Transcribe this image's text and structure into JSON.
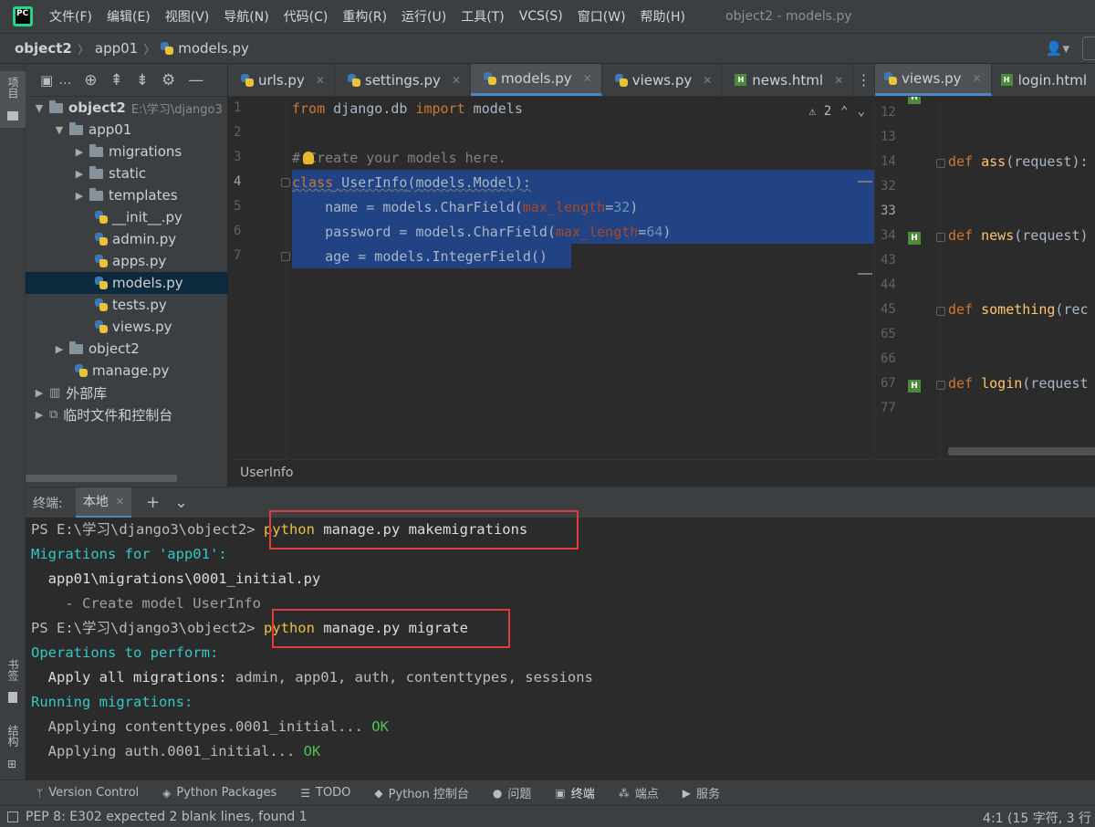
{
  "menubar": {
    "logo_text": "PC",
    "items": [
      "文件(F)",
      "编辑(E)",
      "视图(V)",
      "导航(N)",
      "代码(C)",
      "重构(R)",
      "运行(U)",
      "工具(T)",
      "VCS(S)",
      "窗口(W)",
      "帮助(H)"
    ],
    "window_title": "object2 - models.py"
  },
  "navbar": {
    "crumbs": [
      "object2",
      "app01",
      "models.py"
    ]
  },
  "left_stripe": {
    "project_label": "项目",
    "bookmarks_label": "书签",
    "structure_label": "结构"
  },
  "project": {
    "toolbar_label": "…",
    "tree": [
      {
        "label": "object2",
        "path": "E:\\学习\\django3"
      },
      {
        "label": "app01"
      },
      {
        "label": "migrations"
      },
      {
        "label": "static"
      },
      {
        "label": "templates"
      },
      {
        "label": "__init__.py"
      },
      {
        "label": "admin.py"
      },
      {
        "label": "apps.py"
      },
      {
        "label": "models.py"
      },
      {
        "label": "tests.py"
      },
      {
        "label": "views.py"
      },
      {
        "label": "object2"
      },
      {
        "label": "manage.py"
      },
      {
        "label": "外部库"
      },
      {
        "label": "临时文件和控制台"
      }
    ]
  },
  "editor": {
    "tabs": [
      "urls.py",
      "settings.py",
      "models.py",
      "views.py",
      "news.html"
    ],
    "active_tab": "models.py",
    "warnings_count": "2",
    "line_numbers": [
      "1",
      "2",
      "3",
      "4",
      "5",
      "6",
      "7"
    ],
    "current_line": "4",
    "code": {
      "l1_from": "from",
      "l1_mod": " django.db ",
      "l1_import": "import",
      "l1_rest": " models",
      "l3_hash": "#",
      "l3_text": " Create your models here.",
      "l4_class": "class",
      "l4_name": " UserInfo",
      "l4_rest": "(models.Model):",
      "l5_a": "    name = models.CharField(",
      "l5_p": "max_length",
      "l5_eq": "=",
      "l5_n": "32",
      "l5_c": ")",
      "l6_a": "    password = models.CharField(",
      "l6_p": "max_length",
      "l6_eq": "=",
      "l6_n": "64",
      "l6_c": ")",
      "l7_a": "    age = models.IntegerField()"
    },
    "breadcrumb": "UserInfo"
  },
  "split_editor": {
    "tabs": [
      "views.py",
      "login.html"
    ],
    "line_numbers": [
      "12",
      "13",
      "14",
      "32",
      "33",
      "34",
      "43",
      "44",
      "45",
      "65",
      "66",
      "67",
      "77"
    ],
    "current_line": "33",
    "h_marker": "H",
    "defs": [
      {
        "kw": "def",
        "name": " ass",
        "rest": "(request):"
      },
      {
        "kw": "def",
        "name": " news",
        "rest": "(request)"
      },
      {
        "kw": "def",
        "name": " something",
        "rest": "(rec"
      },
      {
        "kw": "def",
        "name": " login",
        "rest": "(request"
      }
    ]
  },
  "terminal": {
    "title": "终端:",
    "tab_label": "本地",
    "add_icon": "+",
    "dropdown_icon": "⌄",
    "lines": {
      "prompt1": "PS E:\\学习\\django3\\object2> ",
      "cmd1": "python",
      "cmd1_rest": " manage.py makemigrations",
      "mig_for": "Migrations for 'app01':",
      "mig_file": "  app01\\migrations\\0001_initial.py",
      "create_model": "    - Create model UserInfo",
      "prompt2": "PS E:\\学习\\django3\\object2> ",
      "cmd2": "python",
      "cmd2_rest": " manage.py migrate",
      "ops": "Operations to perform:",
      "apply_all_label": "  Apply all migrations:",
      "apply_all_list": " admin, app01, auth, contenttypes, sessions",
      "running": "Running migrations:",
      "applying1": "  Applying contenttypes.0001_initial... ",
      "ok1": "OK",
      "applying2": "  Applying auth.0001_initial... ",
      "ok2": "OK"
    }
  },
  "tool_windows": [
    "Version Control",
    "Python Packages",
    "TODO",
    "Python 控制台",
    "问题",
    "终端",
    "端点",
    "服务"
  ],
  "status": {
    "message": "PEP 8: E302 expected 2 blank lines, found 1",
    "right": "4:1 (15 字符, 3 行"
  }
}
